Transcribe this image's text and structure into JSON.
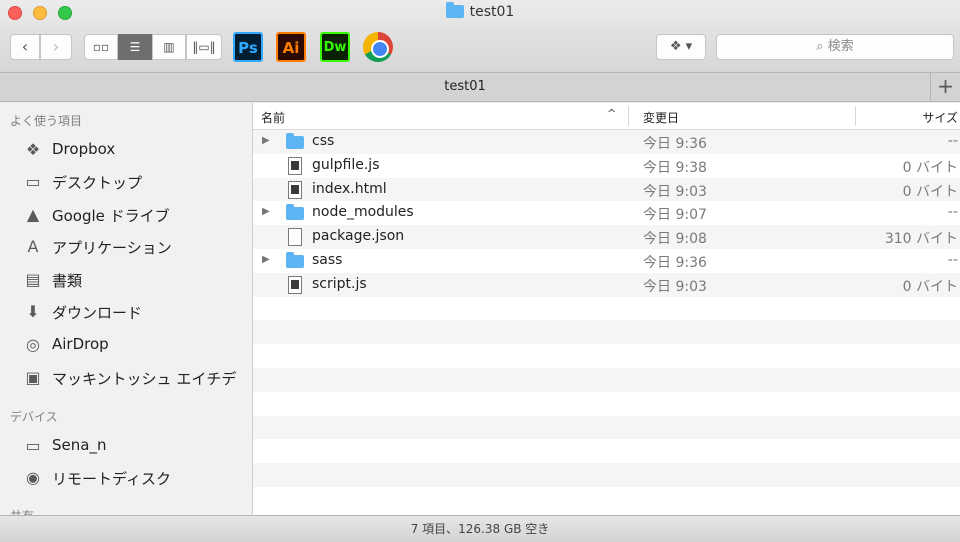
{
  "window": {
    "title": "test01"
  },
  "toolbar": {
    "back_icon": "chevron-left-icon",
    "forward_icon": "chevron-right-icon",
    "views": [
      "icon-view-icon",
      "list-view-icon",
      "column-view-icon",
      "coverflow-view-icon"
    ],
    "apps": [
      {
        "label": "Ps",
        "name": "photoshop-icon"
      },
      {
        "label": "Ai",
        "name": "illustrator-icon"
      },
      {
        "label": "Dw",
        "name": "dreamweaver-icon"
      },
      {
        "label": "",
        "name": "chrome-icon"
      }
    ],
    "search_placeholder": "検索"
  },
  "tab": {
    "title": "test01",
    "add_label": "+"
  },
  "sidebar": {
    "favorites_header": "よく使う項目",
    "favorites": [
      {
        "label": "Dropbox",
        "icon": "dropbox-icon"
      },
      {
        "label": "デスクトップ",
        "icon": "desktop-icon"
      },
      {
        "label": "Google ドライブ",
        "icon": "google-drive-icon"
      },
      {
        "label": "アプリケーション",
        "icon": "applications-icon"
      },
      {
        "label": "書類",
        "icon": "documents-icon"
      },
      {
        "label": "ダウンロード",
        "icon": "downloads-icon"
      },
      {
        "label": "AirDrop",
        "icon": "airdrop-icon"
      },
      {
        "label": "マッキントッシュ エイチデ",
        "icon": "harddisk-icon"
      }
    ],
    "devices_header": "デバイス",
    "devices": [
      {
        "label": "Sena_n",
        "icon": "laptop-icon"
      },
      {
        "label": "リモートディスク",
        "icon": "remote-disc-icon"
      }
    ],
    "shared_header": "共有"
  },
  "columns": {
    "name": "名前",
    "sort_indicator": "^",
    "date": "変更日",
    "size": "サイズ"
  },
  "files": [
    {
      "name": "css",
      "date": "今日 9:36",
      "size": "--",
      "kind": "folder"
    },
    {
      "name": "gulpfile.js",
      "date": "今日 9:38",
      "size": "0 バイト",
      "kind": "doc-dark"
    },
    {
      "name": "index.html",
      "date": "今日 9:03",
      "size": "0 バイト",
      "kind": "doc-dark"
    },
    {
      "name": "node_modules",
      "date": "今日 9:07",
      "size": "--",
      "kind": "folder"
    },
    {
      "name": "package.json",
      "date": "今日 9:08",
      "size": "310 バイト",
      "kind": "doc"
    },
    {
      "name": "sass",
      "date": "今日 9:36",
      "size": "--",
      "kind": "folder"
    },
    {
      "name": "script.js",
      "date": "今日 9:03",
      "size": "0 バイト",
      "kind": "doc-dark"
    }
  ],
  "status": {
    "text": "7 項目、126.38 GB 空き"
  }
}
